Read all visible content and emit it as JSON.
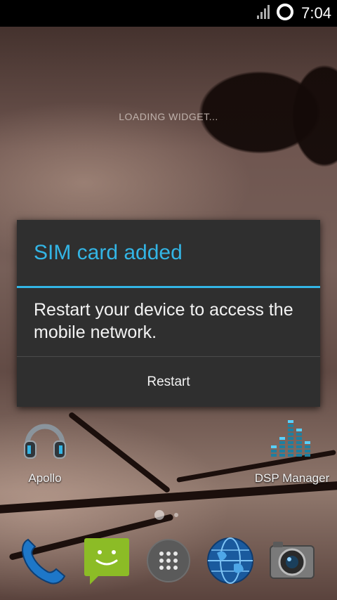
{
  "status_bar": {
    "time": "7:04"
  },
  "home": {
    "widget_placeholder": "LOADING WIDGET...",
    "icons": [
      {
        "label": "Apollo",
        "icon": "headphones-icon"
      },
      {
        "label": "DSP Manager",
        "icon": "equalizer-icon"
      }
    ],
    "page_indicator": {
      "pages": 2,
      "current": 1
    }
  },
  "dock": [
    {
      "icon": "phone-icon"
    },
    {
      "icon": "messaging-icon"
    },
    {
      "icon": "app-drawer-icon"
    },
    {
      "icon": "browser-icon"
    },
    {
      "icon": "camera-icon"
    }
  ],
  "dialog": {
    "title": "SIM card added",
    "message": "Restart your device to access the mobile network.",
    "button": "Restart"
  },
  "colors": {
    "accent": "#33b5e5",
    "dialog_bg": "#2f2f2f"
  }
}
